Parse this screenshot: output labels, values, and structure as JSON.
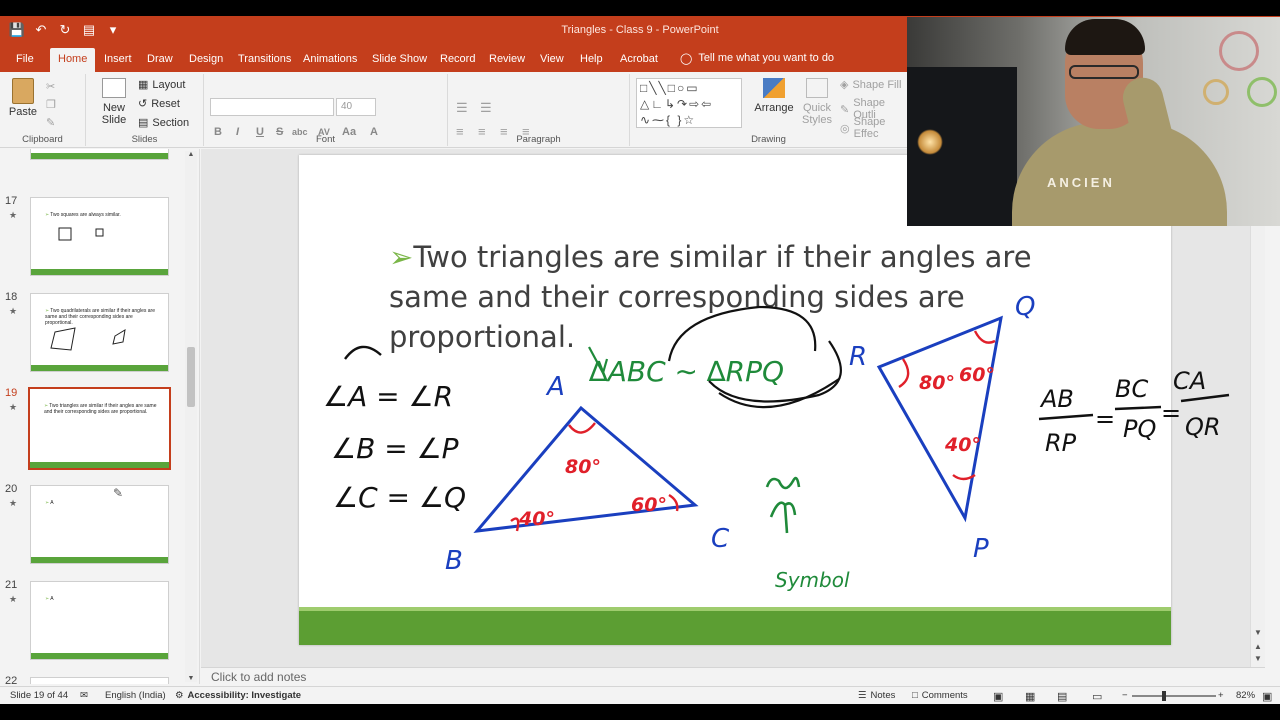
{
  "window": {
    "title": "Triangles - Class 9  -  PowerPoint"
  },
  "quick_access": [
    "save-icon",
    "undo-icon",
    "redo-icon",
    "present-icon",
    "customize-icon"
  ],
  "tabs": [
    "File",
    "Home",
    "Insert",
    "Draw",
    "Design",
    "Transitions",
    "Animations",
    "Slide Show",
    "Record",
    "Review",
    "View",
    "Help",
    "Acrobat"
  ],
  "tell_me": "Tell me what you want to do",
  "ribbon": {
    "clipboard": {
      "label": "Clipboard",
      "paste": "Paste"
    },
    "slides": {
      "label": "Slides",
      "new_slide": "New Slide",
      "layout": "Layout",
      "reset": "Reset",
      "section": "Section"
    },
    "font": {
      "label": "Font",
      "font_name": "",
      "font_size": "40",
      "buttons": [
        "B",
        "I",
        "U",
        "S",
        "abc",
        "AV",
        "Aa",
        "A"
      ]
    },
    "paragraph": {
      "label": "Paragraph"
    },
    "drawing": {
      "label": "Drawing",
      "arrange": "Arrange",
      "quick_styles": "Quick Styles",
      "shape_fill": "Shape Fill",
      "shape_outline": "Shape Outli",
      "shape_effects": "Shape Effec"
    }
  },
  "thumbnails": [
    {
      "num": "17",
      "text": "Two squares are always similar."
    },
    {
      "num": "18",
      "text": "Two quadrilaterals are similar if their angles are same and their corresponding sides are proportional."
    },
    {
      "num": "19",
      "text": "Two triangles are similar if their angles are same and their corresponding sides are proportional."
    },
    {
      "num": "20",
      "text": "A"
    },
    {
      "num": "21",
      "text": "A"
    },
    {
      "num": "22",
      "text": ""
    }
  ],
  "slide": {
    "bullet": "Two triangles are similar if their angles are same and their corresponding sides are proportional.",
    "ink": {
      "angles": [
        "∠A = ∠R",
        "∠B = ∠P",
        "∠C = ∠Q"
      ],
      "similarity": "∆ABC ∼ ∆RPQ",
      "vertices_abc": [
        "A",
        "B",
        "C"
      ],
      "vertices_rpq": [
        "R",
        "Q",
        "P"
      ],
      "angles_abc": [
        "80°",
        "40°",
        "60°"
      ],
      "angles_rpq": [
        "80°",
        "60°",
        "40°"
      ],
      "symbol_label": "Symbol",
      "ratio": {
        "n1": "AB",
        "d1": "RP",
        "n2": "BC",
        "d2": "PQ",
        "n3": "CA",
        "d3": "QR"
      }
    }
  },
  "notes_placeholder": "Click to add notes",
  "status": {
    "slide_info": "Slide 19 of 44",
    "language": "English (India)",
    "accessibility": "Accessibility: Investigate",
    "notes": "Notes",
    "comments": "Comments",
    "zoom": "82%"
  },
  "webcam": {
    "shirt_text": "ANCIEN"
  },
  "colors": {
    "accent": "#c43e1c",
    "slide_band": "#5c9e33",
    "ink_blue": "#1a3fbf",
    "ink_red": "#e0202a",
    "ink_green": "#1f8a3a"
  }
}
